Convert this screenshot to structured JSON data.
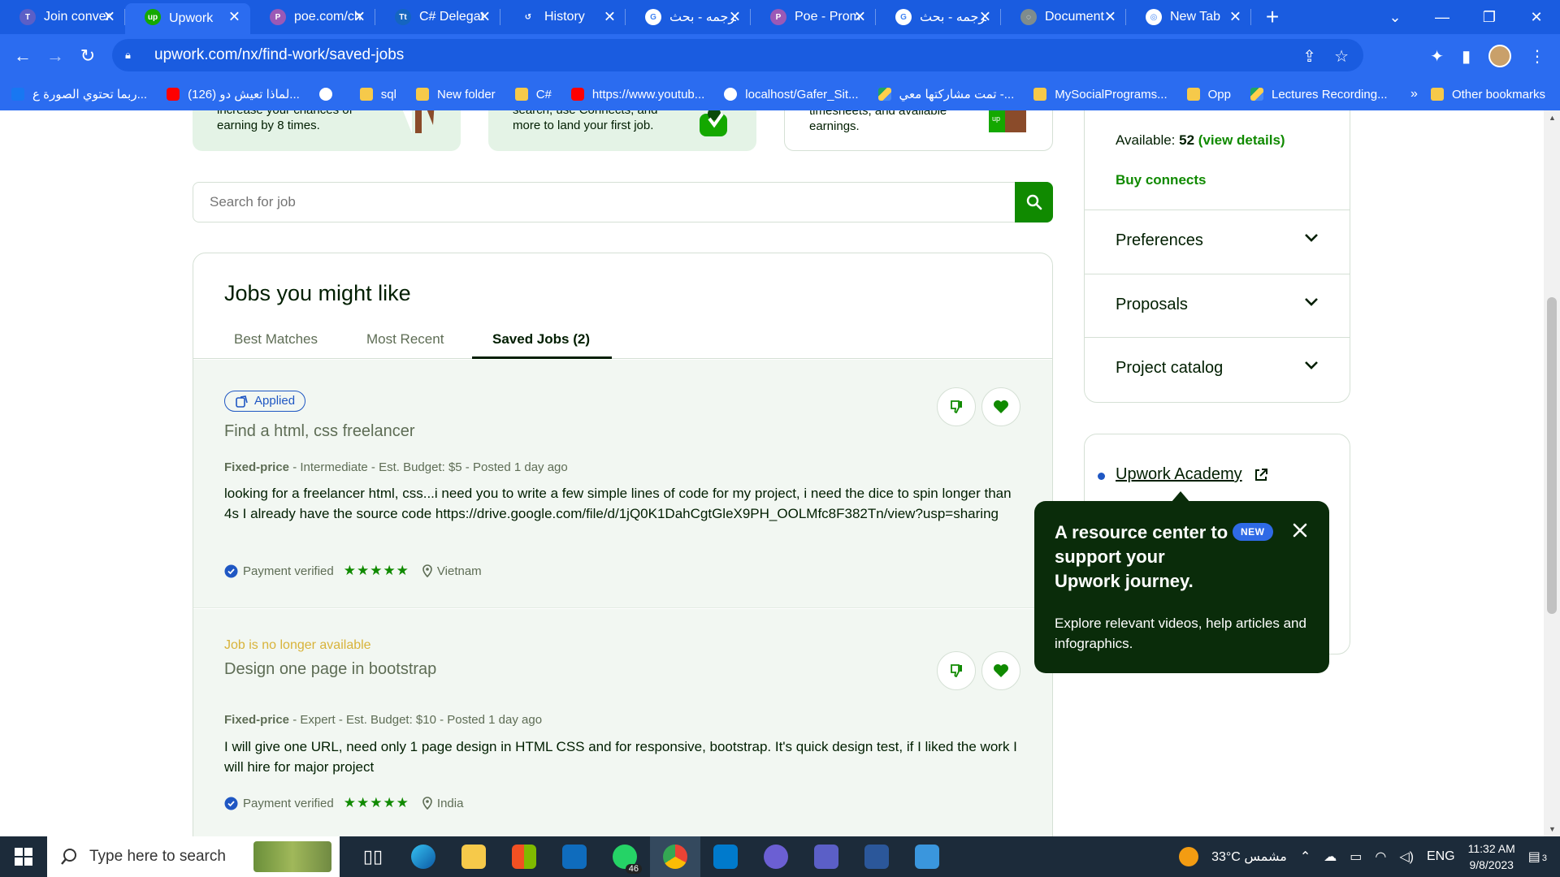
{
  "browser": {
    "tabs": [
      {
        "title": "Join conver",
        "icon": "teams-icon",
        "color": "#5b5fc7",
        "glyph": "T"
      },
      {
        "title": "Upwork",
        "icon": "upwork-icon",
        "color": "#14a800",
        "glyph": "up",
        "active": true
      },
      {
        "title": "poe.com/ch",
        "icon": "poe-icon",
        "color": "#9b59b6",
        "glyph": "P"
      },
      {
        "title": "C# Delegat",
        "icon": "tutorialsteacher-icon",
        "color": "#1565c0",
        "glyph": "Tt"
      },
      {
        "title": "History",
        "icon": "history-icon",
        "color": "transparent",
        "glyph": "↺"
      },
      {
        "title": "ترجمه - بحث",
        "icon": "google-icon",
        "color": "#ffffff",
        "glyph": "G"
      },
      {
        "title": "Poe - Prom",
        "icon": "poe-icon",
        "color": "#9b59b6",
        "glyph": "P"
      },
      {
        "title": "ترجمه - بحث",
        "icon": "google-icon",
        "color": "#ffffff",
        "glyph": "G"
      },
      {
        "title": "Document",
        "icon": "globe-icon",
        "color": "#7f8c8d",
        "glyph": "◌"
      },
      {
        "title": "New Tab",
        "icon": "chrome-icon",
        "color": "#ffffff",
        "glyph": "◎"
      }
    ],
    "url": "upwork.com/nx/find-work/saved-jobs",
    "bookmarks": [
      {
        "label": "ربما تحتوي الصورة ع...",
        "icon": "facebook-icon",
        "kind": "ic-fb"
      },
      {
        "label": "(126) لماذا تعيش دو...",
        "icon": "youtube-icon",
        "kind": "ic-yt"
      },
      {
        "label": "",
        "icon": "globe-icon",
        "kind": "ic-globe"
      },
      {
        "label": "sql",
        "icon": "folder-icon",
        "kind": "ic-folder"
      },
      {
        "label": "New folder",
        "icon": "folder-icon",
        "kind": "ic-folder"
      },
      {
        "label": "C#",
        "icon": "folder-icon",
        "kind": "ic-folder"
      },
      {
        "label": "https://www.youtub...",
        "icon": "youtube-icon",
        "kind": "ic-yt"
      },
      {
        "label": "localhost/Gafer_Sit...",
        "icon": "globe-icon",
        "kind": "ic-globe"
      },
      {
        "label": "تمت مشاركتها معي -...",
        "icon": "drive-icon",
        "kind": "ic-drive"
      },
      {
        "label": "MySocialPrograms...",
        "icon": "folder-icon",
        "kind": "ic-folder"
      },
      {
        "label": "Opp",
        "icon": "folder-icon",
        "kind": "ic-folder"
      },
      {
        "label": "Lectures Recording...",
        "icon": "drive-icon",
        "kind": "ic-drive"
      }
    ],
    "bookmarks_more": "»",
    "other_bookmarks": "Other bookmarks"
  },
  "promos": [
    {
      "lines": [
        "increase your chances of",
        "earning by 8 times."
      ]
    },
    {
      "lines": [
        "search, use Connects, and",
        "more to land your first job."
      ]
    },
    {
      "lines": [
        "timesheets, and available",
        "earnings."
      ]
    }
  ],
  "search": {
    "placeholder": "Search for job"
  },
  "jobs": {
    "title": "Jobs you might like",
    "tabs": [
      "Best Matches",
      "Most Recent",
      "Saved Jobs (2)"
    ],
    "items": [
      {
        "badge": "Applied",
        "title": "Find a html, css freelancer",
        "type": "Fixed-price",
        "meta": " - Intermediate - Est. Budget: $5 - Posted 1 day ago",
        "desc": "looking for a freelancer html, css...i need you to write a few simple lines of code for my project, i need the dice to spin longer than 4s I already have the source code https://drive.google.com/file/d/1jQ0K1DahCgtGleX9PH_OOLMfc8F382Tn/view?usp=sharing",
        "payment": "Payment verified",
        "rating": 5,
        "location": "Vietnam"
      },
      {
        "status": "Job is no longer available",
        "title": "Design one page in bootstrap",
        "type": "Fixed-price",
        "meta": " - Expert - Est. Budget: $10 - Posted 1 day ago",
        "desc": "I will give one URL, need only 1 page design in HTML CSS and for responsive, bootstrap. It's quick design test, if I liked the work I will hire for major project",
        "payment": "Payment verified",
        "rating": 5,
        "location": "India"
      }
    ]
  },
  "sidebar": {
    "available_label": "Available: ",
    "available_count": "52",
    "view_details": "(view details)",
    "buy_connects": "Buy connects",
    "sections": [
      "Preferences",
      "Proposals",
      "Project catalog"
    ],
    "academy_link": "Upwork Academy"
  },
  "tooltip": {
    "title": "A resource center to support your Upwork journey.",
    "badge": "NEW",
    "body": "Explore relevant videos, help articles and infographics."
  },
  "taskbar": {
    "search_placeholder": "Type here to search",
    "whatsapp_badge": "46",
    "weather": "33°C  مشمس",
    "lang": "ENG",
    "time": "11:32 AM",
    "date": "9/8/2023",
    "notifications": "3"
  },
  "colors": {
    "brand_green": "#108a00",
    "browser_blue": "#2b6cf0",
    "tooltip_bg": "#0a2c0a"
  }
}
